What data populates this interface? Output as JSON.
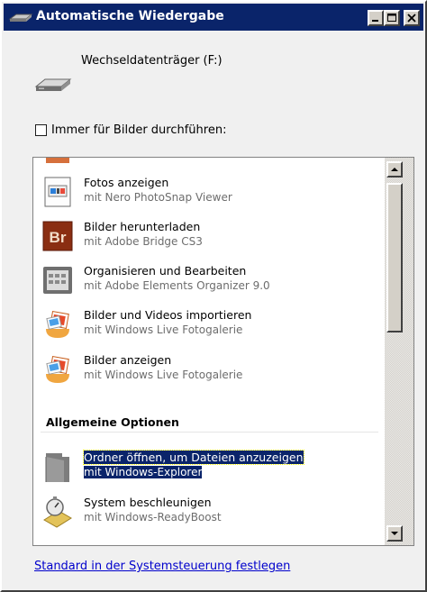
{
  "window": {
    "title": "Automatische Wiedergabe",
    "title_icon": "drive-icon",
    "controls": [
      "minimize-icon",
      "maximize-icon",
      "close-icon"
    ]
  },
  "device": {
    "label": "Wechseldatenträger (F:)",
    "icon": "removable-drive-icon"
  },
  "always_checkbox": {
    "label": "Immer für Bilder durchführen:",
    "checked": false
  },
  "picture_options": [
    {
      "title": "Fotos anzeigen",
      "subtitle": "mit Nero PhotoSnap Viewer",
      "icon": "photo-viewer-icon"
    },
    {
      "title": "Bilder herunterladen",
      "subtitle": "mit Adobe Bridge CS3",
      "icon": "adobe-bridge-icon",
      "icon_text": "Br"
    },
    {
      "title": "Organisieren und Bearbeiten",
      "subtitle": "mit Adobe Elements Organizer 9.0",
      "icon": "organizer-icon"
    },
    {
      "title": "Bilder und Videos importieren",
      "subtitle": "mit Windows Live Fotogalerie",
      "icon": "photo-gallery-icon"
    },
    {
      "title": "Bilder anzeigen",
      "subtitle": "mit Windows Live Fotogalerie",
      "icon": "photo-gallery-icon"
    }
  ],
  "general_section": {
    "header": "Allgemeine Optionen",
    "items": [
      {
        "title": "Ordner öffnen, um Dateien anzuzeigen",
        "subtitle": "mit Windows-Explorer",
        "icon": "folder-icon",
        "selected": true
      },
      {
        "title": "System beschleunigen",
        "subtitle": "mit Windows-ReadyBoost",
        "icon": "readyboost-icon",
        "selected": false
      }
    ]
  },
  "footer": {
    "link": "Standard in der Systemsteuerung festlegen"
  },
  "colors": {
    "titlebar": "#0a246a",
    "selection": "#0a246a",
    "link": "#0000cc",
    "window_bg": "#f0f0f0"
  }
}
